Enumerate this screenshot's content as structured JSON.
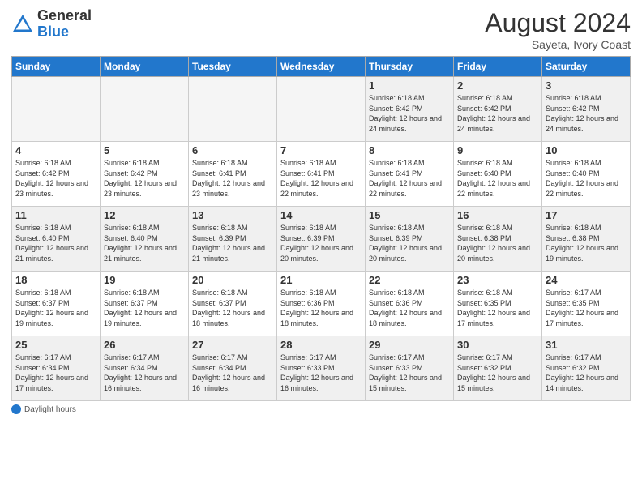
{
  "header": {
    "logo_general": "General",
    "logo_blue": "Blue",
    "month_year": "August 2024",
    "location": "Sayeta, Ivory Coast"
  },
  "days_of_week": [
    "Sunday",
    "Monday",
    "Tuesday",
    "Wednesday",
    "Thursday",
    "Friday",
    "Saturday"
  ],
  "footer": {
    "label": "Daylight hours"
  },
  "weeks": [
    [
      {
        "day": "",
        "empty": true
      },
      {
        "day": "",
        "empty": true
      },
      {
        "day": "",
        "empty": true
      },
      {
        "day": "",
        "empty": true
      },
      {
        "day": "1",
        "sunrise": "Sunrise: 6:18 AM",
        "sunset": "Sunset: 6:42 PM",
        "daylight": "Daylight: 12 hours and 24 minutes."
      },
      {
        "day": "2",
        "sunrise": "Sunrise: 6:18 AM",
        "sunset": "Sunset: 6:42 PM",
        "daylight": "Daylight: 12 hours and 24 minutes."
      },
      {
        "day": "3",
        "sunrise": "Sunrise: 6:18 AM",
        "sunset": "Sunset: 6:42 PM",
        "daylight": "Daylight: 12 hours and 24 minutes."
      }
    ],
    [
      {
        "day": "4",
        "sunrise": "Sunrise: 6:18 AM",
        "sunset": "Sunset: 6:42 PM",
        "daylight": "Daylight: 12 hours and 23 minutes."
      },
      {
        "day": "5",
        "sunrise": "Sunrise: 6:18 AM",
        "sunset": "Sunset: 6:42 PM",
        "daylight": "Daylight: 12 hours and 23 minutes."
      },
      {
        "day": "6",
        "sunrise": "Sunrise: 6:18 AM",
        "sunset": "Sunset: 6:41 PM",
        "daylight": "Daylight: 12 hours and 23 minutes."
      },
      {
        "day": "7",
        "sunrise": "Sunrise: 6:18 AM",
        "sunset": "Sunset: 6:41 PM",
        "daylight": "Daylight: 12 hours and 22 minutes."
      },
      {
        "day": "8",
        "sunrise": "Sunrise: 6:18 AM",
        "sunset": "Sunset: 6:41 PM",
        "daylight": "Daylight: 12 hours and 22 minutes."
      },
      {
        "day": "9",
        "sunrise": "Sunrise: 6:18 AM",
        "sunset": "Sunset: 6:40 PM",
        "daylight": "Daylight: 12 hours and 22 minutes."
      },
      {
        "day": "10",
        "sunrise": "Sunrise: 6:18 AM",
        "sunset": "Sunset: 6:40 PM",
        "daylight": "Daylight: 12 hours and 22 minutes."
      }
    ],
    [
      {
        "day": "11",
        "sunrise": "Sunrise: 6:18 AM",
        "sunset": "Sunset: 6:40 PM",
        "daylight": "Daylight: 12 hours and 21 minutes."
      },
      {
        "day": "12",
        "sunrise": "Sunrise: 6:18 AM",
        "sunset": "Sunset: 6:40 PM",
        "daylight": "Daylight: 12 hours and 21 minutes."
      },
      {
        "day": "13",
        "sunrise": "Sunrise: 6:18 AM",
        "sunset": "Sunset: 6:39 PM",
        "daylight": "Daylight: 12 hours and 21 minutes."
      },
      {
        "day": "14",
        "sunrise": "Sunrise: 6:18 AM",
        "sunset": "Sunset: 6:39 PM",
        "daylight": "Daylight: 12 hours and 20 minutes."
      },
      {
        "day": "15",
        "sunrise": "Sunrise: 6:18 AM",
        "sunset": "Sunset: 6:39 PM",
        "daylight": "Daylight: 12 hours and 20 minutes."
      },
      {
        "day": "16",
        "sunrise": "Sunrise: 6:18 AM",
        "sunset": "Sunset: 6:38 PM",
        "daylight": "Daylight: 12 hours and 20 minutes."
      },
      {
        "day": "17",
        "sunrise": "Sunrise: 6:18 AM",
        "sunset": "Sunset: 6:38 PM",
        "daylight": "Daylight: 12 hours and 19 minutes."
      }
    ],
    [
      {
        "day": "18",
        "sunrise": "Sunrise: 6:18 AM",
        "sunset": "Sunset: 6:37 PM",
        "daylight": "Daylight: 12 hours and 19 minutes."
      },
      {
        "day": "19",
        "sunrise": "Sunrise: 6:18 AM",
        "sunset": "Sunset: 6:37 PM",
        "daylight": "Daylight: 12 hours and 19 minutes."
      },
      {
        "day": "20",
        "sunrise": "Sunrise: 6:18 AM",
        "sunset": "Sunset: 6:37 PM",
        "daylight": "Daylight: 12 hours and 18 minutes."
      },
      {
        "day": "21",
        "sunrise": "Sunrise: 6:18 AM",
        "sunset": "Sunset: 6:36 PM",
        "daylight": "Daylight: 12 hours and 18 minutes."
      },
      {
        "day": "22",
        "sunrise": "Sunrise: 6:18 AM",
        "sunset": "Sunset: 6:36 PM",
        "daylight": "Daylight: 12 hours and 18 minutes."
      },
      {
        "day": "23",
        "sunrise": "Sunrise: 6:18 AM",
        "sunset": "Sunset: 6:35 PM",
        "daylight": "Daylight: 12 hours and 17 minutes."
      },
      {
        "day": "24",
        "sunrise": "Sunrise: 6:17 AM",
        "sunset": "Sunset: 6:35 PM",
        "daylight": "Daylight: 12 hours and 17 minutes."
      }
    ],
    [
      {
        "day": "25",
        "sunrise": "Sunrise: 6:17 AM",
        "sunset": "Sunset: 6:34 PM",
        "daylight": "Daylight: 12 hours and 17 minutes."
      },
      {
        "day": "26",
        "sunrise": "Sunrise: 6:17 AM",
        "sunset": "Sunset: 6:34 PM",
        "daylight": "Daylight: 12 hours and 16 minutes."
      },
      {
        "day": "27",
        "sunrise": "Sunrise: 6:17 AM",
        "sunset": "Sunset: 6:34 PM",
        "daylight": "Daylight: 12 hours and 16 minutes."
      },
      {
        "day": "28",
        "sunrise": "Sunrise: 6:17 AM",
        "sunset": "Sunset: 6:33 PM",
        "daylight": "Daylight: 12 hours and 16 minutes."
      },
      {
        "day": "29",
        "sunrise": "Sunrise: 6:17 AM",
        "sunset": "Sunset: 6:33 PM",
        "daylight": "Daylight: 12 hours and 15 minutes."
      },
      {
        "day": "30",
        "sunrise": "Sunrise: 6:17 AM",
        "sunset": "Sunset: 6:32 PM",
        "daylight": "Daylight: 12 hours and 15 minutes."
      },
      {
        "day": "31",
        "sunrise": "Sunrise: 6:17 AM",
        "sunset": "Sunset: 6:32 PM",
        "daylight": "Daylight: 12 hours and 14 minutes."
      }
    ]
  ]
}
